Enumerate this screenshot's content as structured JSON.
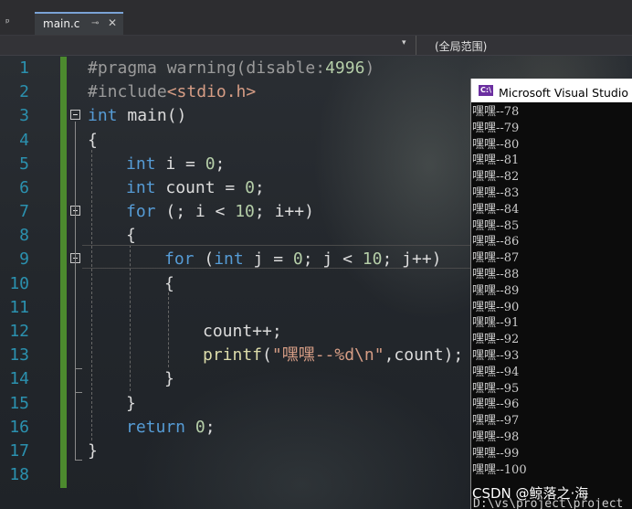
{
  "tab": {
    "label": "main.c",
    "pin_glyph": "⊸",
    "close_glyph": "✕",
    "left_pin_glyph": "ᵖ"
  },
  "navbar": {
    "scope": "(全局范围)",
    "dropdown_glyph": "▾"
  },
  "line_numbers": [
    "1",
    "2",
    "3",
    "4",
    "5",
    "6",
    "7",
    "8",
    "9",
    "10",
    "11",
    "12",
    "13",
    "14",
    "15",
    "16",
    "17",
    "18"
  ],
  "code": {
    "l1": {
      "pp": "#pragma warning(disable:",
      "num": "4996",
      "end": ")"
    },
    "l2": {
      "pp": "#include",
      "inc": "<stdio.h>"
    },
    "l3": {
      "kw": "int",
      "rest": " main()"
    },
    "l4": {
      "text": "{"
    },
    "l5": {
      "kw": "int",
      "a": " i = ",
      "num": "0",
      "b": ";"
    },
    "l6": {
      "kw": "int",
      "a": " count = ",
      "num": "0",
      "b": ";"
    },
    "l7": {
      "kw": "for",
      "a": " (; i < ",
      "num": "10",
      "b": "; i++)"
    },
    "l8": {
      "text": "{"
    },
    "l9": {
      "kw": "for",
      "a": " (",
      "kw2": "int",
      "b": " j = ",
      "num": "0",
      "c": "; j < ",
      "num2": "10",
      "d": "; j++)"
    },
    "l10": {
      "text": "{"
    },
    "l12": {
      "text": "count++;"
    },
    "l13": {
      "fn": "printf",
      "a": "(",
      "str": "\"嘿嘿--%d\\n\"",
      "b": ",count);"
    },
    "l14": {
      "text": "}"
    },
    "l15": {
      "text": "}"
    },
    "l16": {
      "kw": "return",
      "a": " ",
      "num": "0",
      "b": ";"
    },
    "l17": {
      "text": "}"
    }
  },
  "console": {
    "title": "Microsoft Visual Studio 调",
    "icon_text": "C:\\",
    "lines": [
      "嘿嘿--78",
      "嘿嘿--79",
      "嘿嘿--80",
      "嘿嘿--81",
      "嘿嘿--82",
      "嘿嘿--83",
      "嘿嘿--84",
      "嘿嘿--85",
      "嘿嘿--86",
      "嘿嘿--87",
      "嘿嘿--88",
      "嘿嘿--89",
      "嘿嘿--90",
      "嘿嘿--91",
      "嘿嘿--92",
      "嘿嘿--93",
      "嘿嘿--94",
      "嘿嘿--95",
      "嘿嘿--96",
      "嘿嘿--97",
      "嘿嘿--98",
      "嘿嘿--99",
      "嘿嘿--100"
    ],
    "path": "D:\\vs\\project\\project"
  },
  "watermark": "CSDN @鲸落之·海"
}
